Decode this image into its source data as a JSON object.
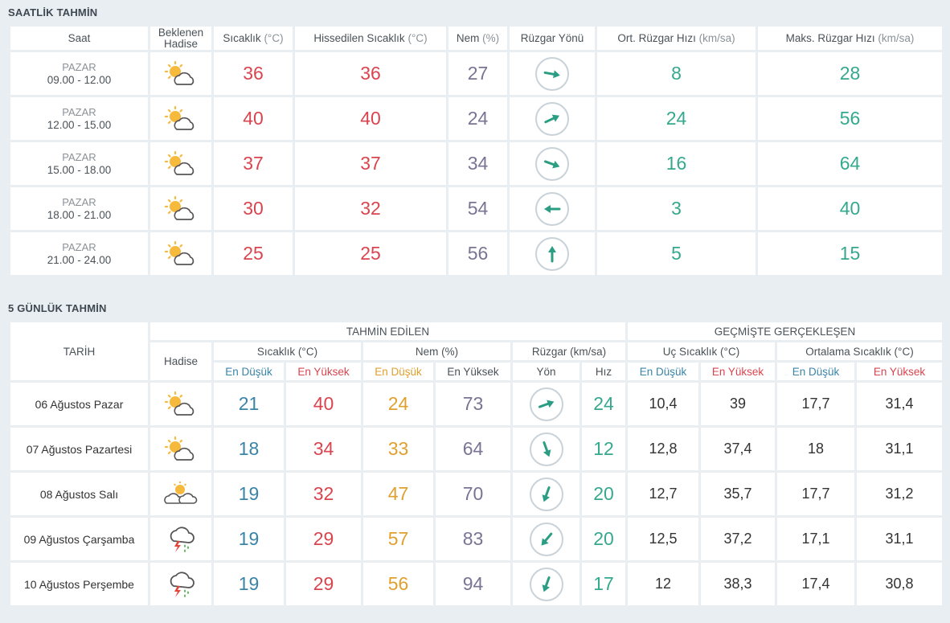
{
  "hourly": {
    "title": "SAATLİK TAHMİN",
    "headers": {
      "saat": "Saat",
      "hadise": "Beklenen Hadise",
      "sicaklik": "Sıcaklık",
      "sicaklik_unit": "(°C)",
      "hissedilen": "Hissedilen Sıcaklık",
      "hissedilen_unit": "(°C)",
      "nem": "Nem",
      "nem_unit": "(%)",
      "ruzgar_yonu": "Rüzgar Yönü",
      "ort_ruzgar": "Ort. Rüzgar Hızı",
      "ort_ruzgar_unit": "(km/sa)",
      "maks_ruzgar": "Maks. Rüzgar Hızı",
      "maks_ruzgar_unit": "(km/sa)"
    },
    "rows": [
      {
        "day": "PAZAR",
        "time": "09.00 - 12.00",
        "icon": "partly-sunny-icon",
        "temp": "36",
        "feels": "36",
        "humidity": "27",
        "wind_dir_deg": 100,
        "avg_wind": "8",
        "max_wind": "28"
      },
      {
        "day": "PAZAR",
        "time": "12.00 - 15.00",
        "icon": "partly-sunny-icon",
        "temp": "40",
        "feels": "40",
        "humidity": "24",
        "wind_dir_deg": 65,
        "avg_wind": "24",
        "max_wind": "56"
      },
      {
        "day": "PAZAR",
        "time": "15.00 - 18.00",
        "icon": "partly-sunny-icon",
        "temp": "37",
        "feels": "37",
        "humidity": "34",
        "wind_dir_deg": 110,
        "avg_wind": "16",
        "max_wind": "64"
      },
      {
        "day": "PAZAR",
        "time": "18.00 - 21.00",
        "icon": "partly-sunny-icon",
        "temp": "30",
        "feels": "32",
        "humidity": "54",
        "wind_dir_deg": 270,
        "avg_wind": "3",
        "max_wind": "40"
      },
      {
        "day": "PAZAR",
        "time": "21.00 - 24.00",
        "icon": "partly-sunny-icon",
        "temp": "25",
        "feels": "25",
        "humidity": "56",
        "wind_dir_deg": 0,
        "avg_wind": "5",
        "max_wind": "15"
      }
    ]
  },
  "daily": {
    "title": "5 GÜNLÜK TAHMİN",
    "headers": {
      "tarih": "TARİH",
      "tahmin_edilen": "TAHMİN EDİLEN",
      "gecmiste": "GEÇMİŞTE GERÇEKLEŞEN",
      "hadise": "Hadise",
      "sicaklik": "Sıcaklık (°C)",
      "nem": "Nem (%)",
      "ruzgar": "Rüzgar (km/sa)",
      "uc_sicaklik": "Uç Sıcaklık (°C)",
      "ortalama_sicaklik": "Ortalama Sıcaklık (°C)",
      "en_dusuk": "En Düşük",
      "en_yuksek": "En Yüksek",
      "yon": "Yön",
      "hiz": "Hız"
    },
    "rows": [
      {
        "date": "06 Ağustos Pazar",
        "icon": "partly-sunny-icon",
        "temp_low": "21",
        "temp_high": "40",
        "hum_low": "24",
        "hum_high": "73",
        "wind_dir_deg": 70,
        "wind_speed": "24",
        "ext_low": "10,4",
        "ext_high": "39",
        "avg_low": "17,7",
        "avg_high": "31,4"
      },
      {
        "date": "07 Ağustos Pazartesi",
        "icon": "partly-sunny-icon",
        "temp_low": "18",
        "temp_high": "34",
        "hum_low": "33",
        "hum_high": "64",
        "wind_dir_deg": 160,
        "wind_speed": "12",
        "ext_low": "12,8",
        "ext_high": "37,4",
        "avg_low": "18",
        "avg_high": "31,1"
      },
      {
        "date": "08 Ağustos Salı",
        "icon": "cloudy-sunny-icon",
        "temp_low": "19",
        "temp_high": "32",
        "hum_low": "47",
        "hum_high": "70",
        "wind_dir_deg": 200,
        "wind_speed": "20",
        "ext_low": "12,7",
        "ext_high": "35,7",
        "avg_low": "17,7",
        "avg_high": "31,2"
      },
      {
        "date": "09 Ağustos Çarşamba",
        "icon": "thunderstorm-icon",
        "temp_low": "19",
        "temp_high": "29",
        "hum_low": "57",
        "hum_high": "83",
        "wind_dir_deg": 220,
        "wind_speed": "20",
        "ext_low": "12,5",
        "ext_high": "37,2",
        "avg_low": "17,1",
        "avg_high": "31,1"
      },
      {
        "date": "10 Ağustos Perşembe",
        "icon": "thunderstorm-icon",
        "temp_low": "19",
        "temp_high": "29",
        "hum_low": "56",
        "hum_high": "94",
        "wind_dir_deg": 200,
        "wind_speed": "17",
        "ext_low": "12",
        "ext_high": "38,3",
        "avg_low": "17,4",
        "avg_high": "30,8"
      }
    ]
  },
  "colors": {
    "temperature": "#d9454f",
    "humidity": "#7a7494",
    "wind": "#35a88e",
    "low": "#3a84a8",
    "humidity_low": "#e0a02d"
  }
}
